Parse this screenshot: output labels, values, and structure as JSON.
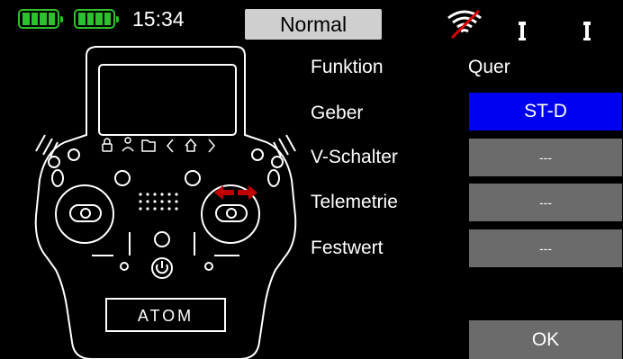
{
  "status": {
    "time": "15:34",
    "mode": "Normal"
  },
  "device": {
    "brand": "ATOM"
  },
  "form": {
    "funktion_label": "Funktion",
    "funktion_value": "Quer",
    "geber_label": "Geber",
    "geber_value": "ST-D",
    "vschalter_label": "V-Schalter",
    "vschalter_value": "---",
    "telemetrie_label": "Telemetrie",
    "telemetrie_value": "---",
    "festwert_label": "Festwert",
    "festwert_value": "---"
  },
  "ok_label": "OK",
  "colors": {
    "battery": "#2ec02e",
    "selected": "#0000f0",
    "button": "#6b6b6b",
    "arrow": "#c00000",
    "no_signal": "#e00000"
  },
  "icons": [
    "battery-icon",
    "battery-icon",
    "wifi-off-icon",
    "antenna-icon",
    "antenna-icon",
    "lock-icon",
    "user-icon",
    "folder-icon",
    "back-icon",
    "home-icon",
    "forward-icon",
    "power-icon"
  ]
}
